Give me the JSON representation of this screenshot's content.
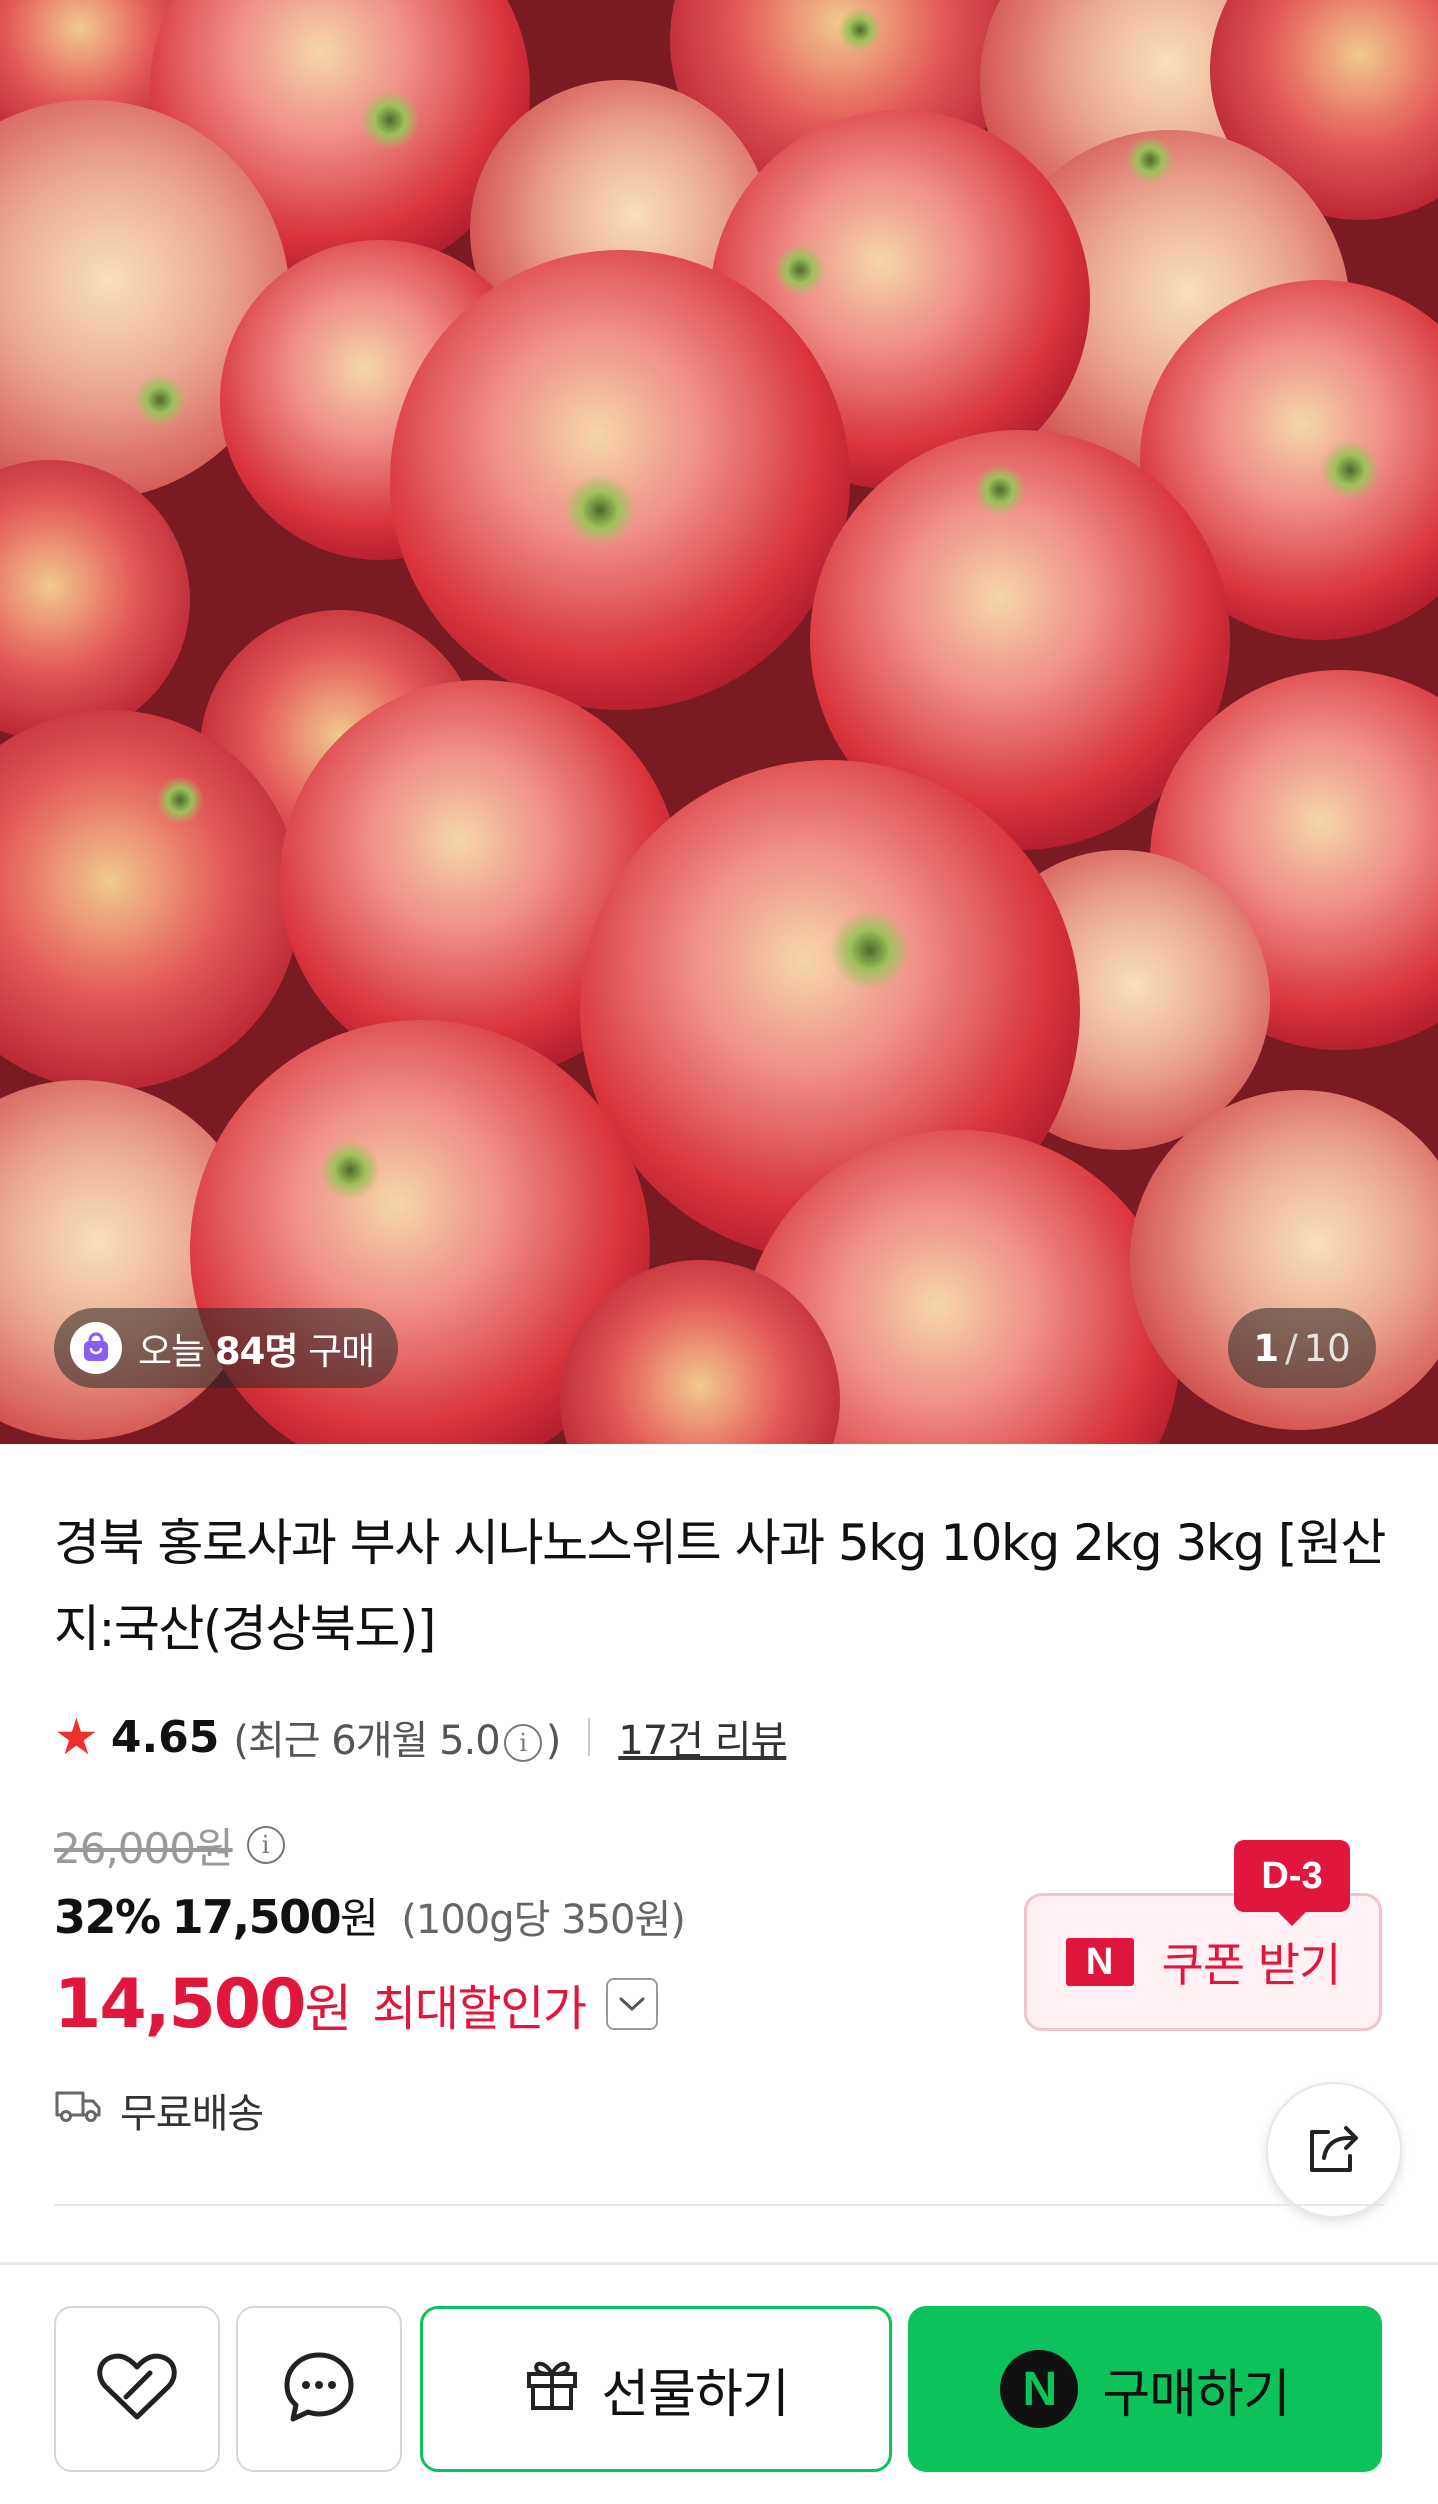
{
  "hero": {
    "today_prefix": "오늘 ",
    "today_count": "84명",
    "today_suffix": " 구매",
    "page_current": "1",
    "page_total": "10"
  },
  "product": {
    "title": "경북 홍로사과 부사 시나노스위트 사과 5kg 10kg 2kg 3kg [원산지:국산(경상북도)]",
    "rating": "4.65",
    "recent_rating": "(최근 6개월 5.0",
    "recent_close": ")",
    "review_count": "17건 리뷰",
    "original_price": "26,000원",
    "discount_pct": "32%",
    "sale_price": "17,500",
    "sale_unit": "원",
    "unit_price": "(100g당 350원)",
    "max_price": "14,500",
    "max_unit": "원",
    "max_label": "최대할인가",
    "coupon_label": "쿠폰 받기",
    "coupon_dday": "D-3",
    "naver_mark": "N",
    "shipping": "무료배송"
  },
  "actions": {
    "gift_label": "선물하기",
    "buy_label": "구매하기",
    "buy_mark": "N"
  },
  "colors": {
    "accent_red": "#e0163c",
    "naver_green": "#0bc35a",
    "star": "#f0302a"
  }
}
